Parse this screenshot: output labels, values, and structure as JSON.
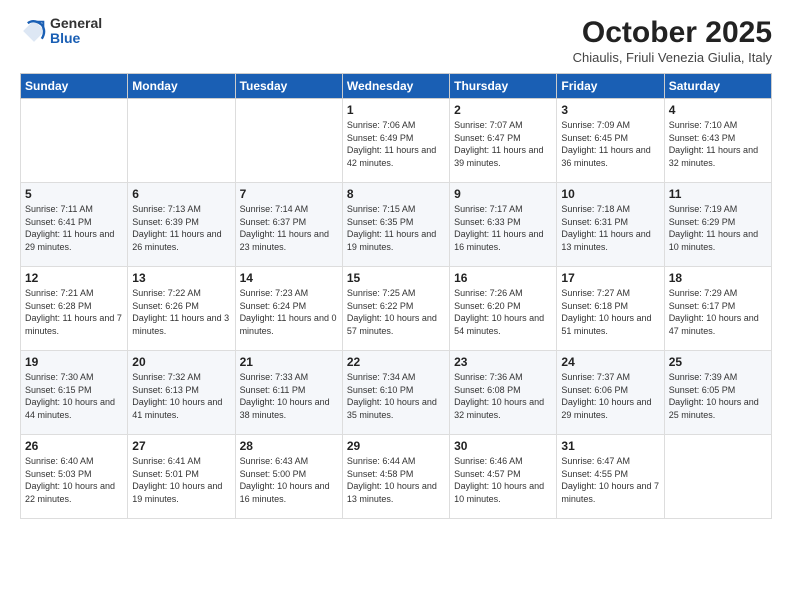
{
  "logo": {
    "general": "General",
    "blue": "Blue"
  },
  "header": {
    "month": "October 2025",
    "subtitle": "Chiaulis, Friuli Venezia Giulia, Italy"
  },
  "weekdays": [
    "Sunday",
    "Monday",
    "Tuesday",
    "Wednesday",
    "Thursday",
    "Friday",
    "Saturday"
  ],
  "weeks": [
    [
      {
        "day": "",
        "info": ""
      },
      {
        "day": "",
        "info": ""
      },
      {
        "day": "",
        "info": ""
      },
      {
        "day": "1",
        "info": "Sunrise: 7:06 AM\nSunset: 6:49 PM\nDaylight: 11 hours\nand 42 minutes."
      },
      {
        "day": "2",
        "info": "Sunrise: 7:07 AM\nSunset: 6:47 PM\nDaylight: 11 hours\nand 39 minutes."
      },
      {
        "day": "3",
        "info": "Sunrise: 7:09 AM\nSunset: 6:45 PM\nDaylight: 11 hours\nand 36 minutes."
      },
      {
        "day": "4",
        "info": "Sunrise: 7:10 AM\nSunset: 6:43 PM\nDaylight: 11 hours\nand 32 minutes."
      }
    ],
    [
      {
        "day": "5",
        "info": "Sunrise: 7:11 AM\nSunset: 6:41 PM\nDaylight: 11 hours\nand 29 minutes."
      },
      {
        "day": "6",
        "info": "Sunrise: 7:13 AM\nSunset: 6:39 PM\nDaylight: 11 hours\nand 26 minutes."
      },
      {
        "day": "7",
        "info": "Sunrise: 7:14 AM\nSunset: 6:37 PM\nDaylight: 11 hours\nand 23 minutes."
      },
      {
        "day": "8",
        "info": "Sunrise: 7:15 AM\nSunset: 6:35 PM\nDaylight: 11 hours\nand 19 minutes."
      },
      {
        "day": "9",
        "info": "Sunrise: 7:17 AM\nSunset: 6:33 PM\nDaylight: 11 hours\nand 16 minutes."
      },
      {
        "day": "10",
        "info": "Sunrise: 7:18 AM\nSunset: 6:31 PM\nDaylight: 11 hours\nand 13 minutes."
      },
      {
        "day": "11",
        "info": "Sunrise: 7:19 AM\nSunset: 6:29 PM\nDaylight: 11 hours\nand 10 minutes."
      }
    ],
    [
      {
        "day": "12",
        "info": "Sunrise: 7:21 AM\nSunset: 6:28 PM\nDaylight: 11 hours\nand 7 minutes."
      },
      {
        "day": "13",
        "info": "Sunrise: 7:22 AM\nSunset: 6:26 PM\nDaylight: 11 hours\nand 3 minutes."
      },
      {
        "day": "14",
        "info": "Sunrise: 7:23 AM\nSunset: 6:24 PM\nDaylight: 11 hours\nand 0 minutes."
      },
      {
        "day": "15",
        "info": "Sunrise: 7:25 AM\nSunset: 6:22 PM\nDaylight: 10 hours\nand 57 minutes."
      },
      {
        "day": "16",
        "info": "Sunrise: 7:26 AM\nSunset: 6:20 PM\nDaylight: 10 hours\nand 54 minutes."
      },
      {
        "day": "17",
        "info": "Sunrise: 7:27 AM\nSunset: 6:18 PM\nDaylight: 10 hours\nand 51 minutes."
      },
      {
        "day": "18",
        "info": "Sunrise: 7:29 AM\nSunset: 6:17 PM\nDaylight: 10 hours\nand 47 minutes."
      }
    ],
    [
      {
        "day": "19",
        "info": "Sunrise: 7:30 AM\nSunset: 6:15 PM\nDaylight: 10 hours\nand 44 minutes."
      },
      {
        "day": "20",
        "info": "Sunrise: 7:32 AM\nSunset: 6:13 PM\nDaylight: 10 hours\nand 41 minutes."
      },
      {
        "day": "21",
        "info": "Sunrise: 7:33 AM\nSunset: 6:11 PM\nDaylight: 10 hours\nand 38 minutes."
      },
      {
        "day": "22",
        "info": "Sunrise: 7:34 AM\nSunset: 6:10 PM\nDaylight: 10 hours\nand 35 minutes."
      },
      {
        "day": "23",
        "info": "Sunrise: 7:36 AM\nSunset: 6:08 PM\nDaylight: 10 hours\nand 32 minutes."
      },
      {
        "day": "24",
        "info": "Sunrise: 7:37 AM\nSunset: 6:06 PM\nDaylight: 10 hours\nand 29 minutes."
      },
      {
        "day": "25",
        "info": "Sunrise: 7:39 AM\nSunset: 6:05 PM\nDaylight: 10 hours\nand 25 minutes."
      }
    ],
    [
      {
        "day": "26",
        "info": "Sunrise: 6:40 AM\nSunset: 5:03 PM\nDaylight: 10 hours\nand 22 minutes."
      },
      {
        "day": "27",
        "info": "Sunrise: 6:41 AM\nSunset: 5:01 PM\nDaylight: 10 hours\nand 19 minutes."
      },
      {
        "day": "28",
        "info": "Sunrise: 6:43 AM\nSunset: 5:00 PM\nDaylight: 10 hours\nand 16 minutes."
      },
      {
        "day": "29",
        "info": "Sunrise: 6:44 AM\nSunset: 4:58 PM\nDaylight: 10 hours\nand 13 minutes."
      },
      {
        "day": "30",
        "info": "Sunrise: 6:46 AM\nSunset: 4:57 PM\nDaylight: 10 hours\nand 10 minutes."
      },
      {
        "day": "31",
        "info": "Sunrise: 6:47 AM\nSunset: 4:55 PM\nDaylight: 10 hours\nand 7 minutes."
      },
      {
        "day": "",
        "info": ""
      }
    ]
  ]
}
